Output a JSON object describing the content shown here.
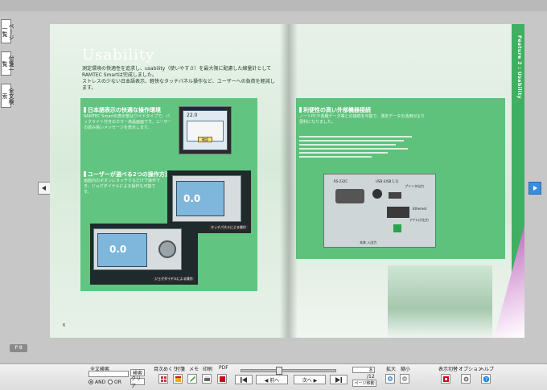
{
  "side_tabs": [
    "ページ一覧",
    "付箋一覧",
    "全文検索"
  ],
  "page_badge": "P 8",
  "book": {
    "title": "Usability",
    "lead_1": "測定環境の快適性を追求し、usability（使いやすさ）を最大限に配慮した線量計として",
    "lead_2": "RAMTEC Smartは完成しました。",
    "lead_3": "ストレスの少ない日本語表示、軽快なタッチパネル操作など、ユーザーへの負荷を軽減します。",
    "sec1_heading": "日本語表示の快適な操作環境",
    "sec1_body": "RAMTEC Smartの表示部はワイドタイプで、バックライト付きのカラー液晶画面です。ユーザーの読み易いメッセージを表示します。",
    "sec2_heading": "ユーザーが選べる2つの操作方法",
    "sec2_body": "画面内のボタンにタッチするだけで操作でき、ジョグダイヤルによる操作も可能です。",
    "sec3_heading": "利便性の高い外部機器接続",
    "sec3_body": "ノートPCや各種データ等との接続を可能で、測定データの活用がより便利になりました。",
    "screen_value_1": "22.0",
    "screen_value_2": "0.0",
    "screen_dialog_button": "確認",
    "caption_touch": "タッチパネルによる操作",
    "caption_jog": "ジョグダイヤルによる操作",
    "port_labels": [
      "RS-232C",
      "USB (USB 1.1)",
      "プリンタ出力",
      "Ethernet",
      "アナログ出力"
    ],
    "panel_caption": "本体 入出力",
    "band_text": "Feature 2 : Usability",
    "page_num_left": "6",
    "page_num_right": "7"
  },
  "toolbar": {
    "fulltext_label": "全文検索",
    "search_button": "検索",
    "clear_button": "クリア",
    "and_label": "AND",
    "or_label": "OR",
    "labels": [
      "目次めくり",
      "付箋",
      "メモ",
      "印刷",
      "PDF"
    ],
    "prev_button": "◀ 前へ",
    "next_button": "次へ ▶",
    "page_current": "8",
    "page_total": "/12",
    "page_jump_button": "ページ移動",
    "zoom_in_label": "拡大",
    "zoom_out_label": "縮小",
    "display_toggle_label": "表示切替",
    "options_label": "オプション",
    "help_label": "ヘルプ",
    "slider_value": 0.4
  }
}
